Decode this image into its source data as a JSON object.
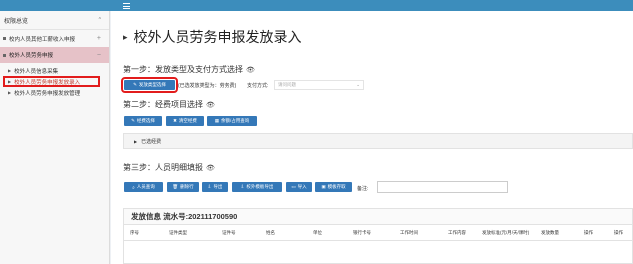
{
  "sidebar": {
    "header": "权限总览",
    "items": [
      {
        "label": "校内人员其他工薪收入申报"
      },
      {
        "label": "校外人员劳务申报"
      },
      {
        "label": "校外人员信息采集"
      },
      {
        "label": "校外人员劳务申报发放录入"
      },
      {
        "label": "校外人员劳务申报发放管理"
      }
    ]
  },
  "main": {
    "title": "校外人员劳务申报发放录入",
    "step1": {
      "label": "第一步：发放类型及支付方式选择",
      "button": "发放类型选择",
      "type_text": "(已选发放类型为：劳务费)",
      "pay_label": "支付方式:",
      "pay_placeholder": "请问问题"
    },
    "step2": {
      "label": "第二步：经费项目选择",
      "buttons": [
        "经费选择",
        "清空经费",
        "余额/占用查询"
      ],
      "selected": "已选经费"
    },
    "step3": {
      "label": "第三步：人员明细填报",
      "buttons": [
        "人员查询",
        "删除行",
        "导出",
        "校外模板导出",
        "导入",
        "模板存取"
      ],
      "note_label": "备注:"
    },
    "grid": {
      "title": "发放信息 流水号:202111700590",
      "columns": [
        "序号",
        "证件类型",
        "证件号",
        "姓名",
        "单位",
        "银行卡号",
        "工作时间",
        "工作内容",
        "发放标准(元/月/天/课时)",
        "发放数量",
        "操作",
        "操作"
      ]
    }
  }
}
